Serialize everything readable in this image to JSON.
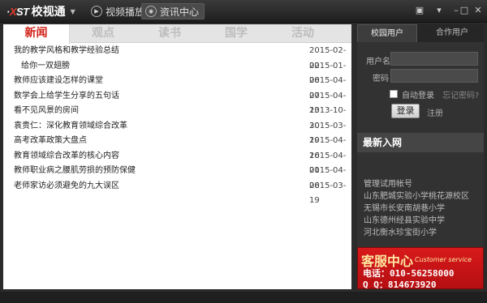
{
  "app": {
    "logo_prefix": "·",
    "logo_x": "X",
    "logo_rest": "ST",
    "name": "校视通",
    "nav": [
      {
        "label": "视频播放",
        "icon": "play-icon"
      },
      {
        "label": "资讯中心",
        "icon": "news-icon"
      }
    ]
  },
  "news": {
    "tabs": [
      "新闻",
      "观点",
      "读书",
      "国学",
      "活动"
    ],
    "items": [
      {
        "title": "我的教学风格和教学经验总结",
        "date": "2015-02-02"
      },
      {
        "title": "给你一双翅膀",
        "date": "2015-01-08"
      },
      {
        "title": "教师应该建设怎样的课堂",
        "date": "2015-04-07"
      },
      {
        "title": "数学会上给学生分享的五句话",
        "date": "2015-04-13"
      },
      {
        "title": "看不见风景的房间",
        "date": "2013-10-30"
      },
      {
        "title": "袁贵仁：深化教育领域综合改革",
        "date": "2015-03-19"
      },
      {
        "title": "高考改革政策大盘点",
        "date": "2015-04-16"
      },
      {
        "title": "教育领域综合改革的核心内容",
        "date": "2015-04-01"
      },
      {
        "title": "教师职业病之腰肌劳损的预防保健",
        "date": "2015-04-08"
      },
      {
        "title": "老师家访必须避免的九大误区",
        "date": "2015-03-19"
      }
    ]
  },
  "login": {
    "tabs": [
      "校园用户",
      "合作用户"
    ],
    "username_label": "用户名",
    "password_label": "密码",
    "auto_login": "自动登录",
    "forgot": "忘记密码?",
    "login_button": "登录",
    "register": "注册"
  },
  "new_users": {
    "heading": "最新入网",
    "items": [
      "管理试用帐号",
      "山东肥城实验小学桃花源校区",
      "无锡市长安南胡巷小学",
      "山东德州经县实验中学",
      "河北衡水珍宝街小学"
    ]
  },
  "banner": {
    "title": "客服中心",
    "subtitle": "Customer service",
    "phone": "电话：010-56258000",
    "qq": "Q  Q：814673920"
  },
  "colors": {
    "accent": "#d2231a",
    "background": "#2b2b2b",
    "banner_red": "#d8191b"
  }
}
